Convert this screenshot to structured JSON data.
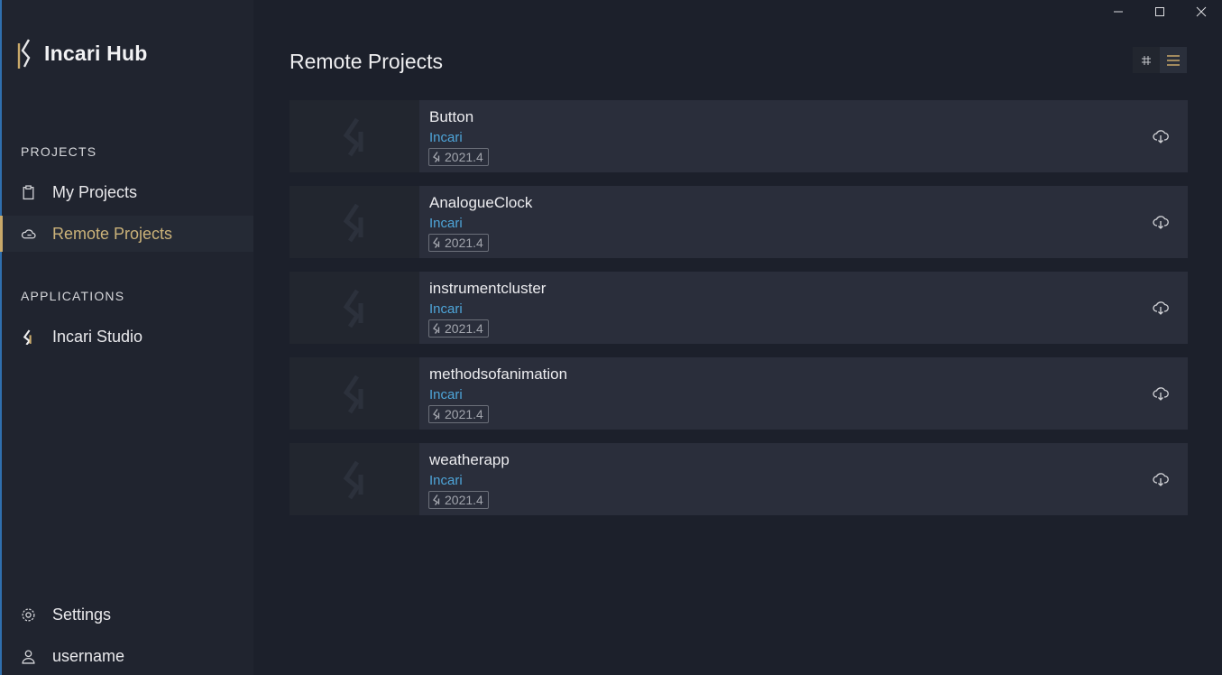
{
  "app": {
    "title": "Incari Hub"
  },
  "window_controls": {
    "minimize_icon": "minimize-icon",
    "maximize_icon": "maximize-icon",
    "close_icon": "close-icon"
  },
  "sidebar": {
    "projects_heading": "PROJECTS",
    "projects_items": [
      {
        "label": "My Projects",
        "icon": "clipboard-icon",
        "active": false
      },
      {
        "label": "Remote Projects",
        "icon": "cloud-icon",
        "active": true
      }
    ],
    "applications_heading": "APPLICATIONS",
    "applications_items": [
      {
        "label": "Incari Studio",
        "icon": "incari-studio-icon"
      }
    ],
    "settings_label": "Settings",
    "user_label": "username"
  },
  "main": {
    "title": "Remote Projects",
    "view_modes": {
      "grid_icon": "hash-grid-icon",
      "list_icon": "list-icon",
      "selected": "list"
    },
    "projects": [
      {
        "name": "Button",
        "owner": "Incari",
        "version": "2021.4"
      },
      {
        "name": "AnalogueClock",
        "owner": "Incari",
        "version": "2021.4"
      },
      {
        "name": "instrumentcluster",
        "owner": "Incari",
        "version": "2021.4"
      },
      {
        "name": "methodsofanimation",
        "owner": "Incari",
        "version": "2021.4"
      },
      {
        "name": "weatherapp",
        "owner": "Incari",
        "version": "2021.4"
      }
    ]
  },
  "colors": {
    "accent_gold": "#c9a96a",
    "link_blue": "#4ea5d9",
    "background": "#1c202b",
    "sidebar": "#20242f",
    "card": "#2a2e3b"
  }
}
